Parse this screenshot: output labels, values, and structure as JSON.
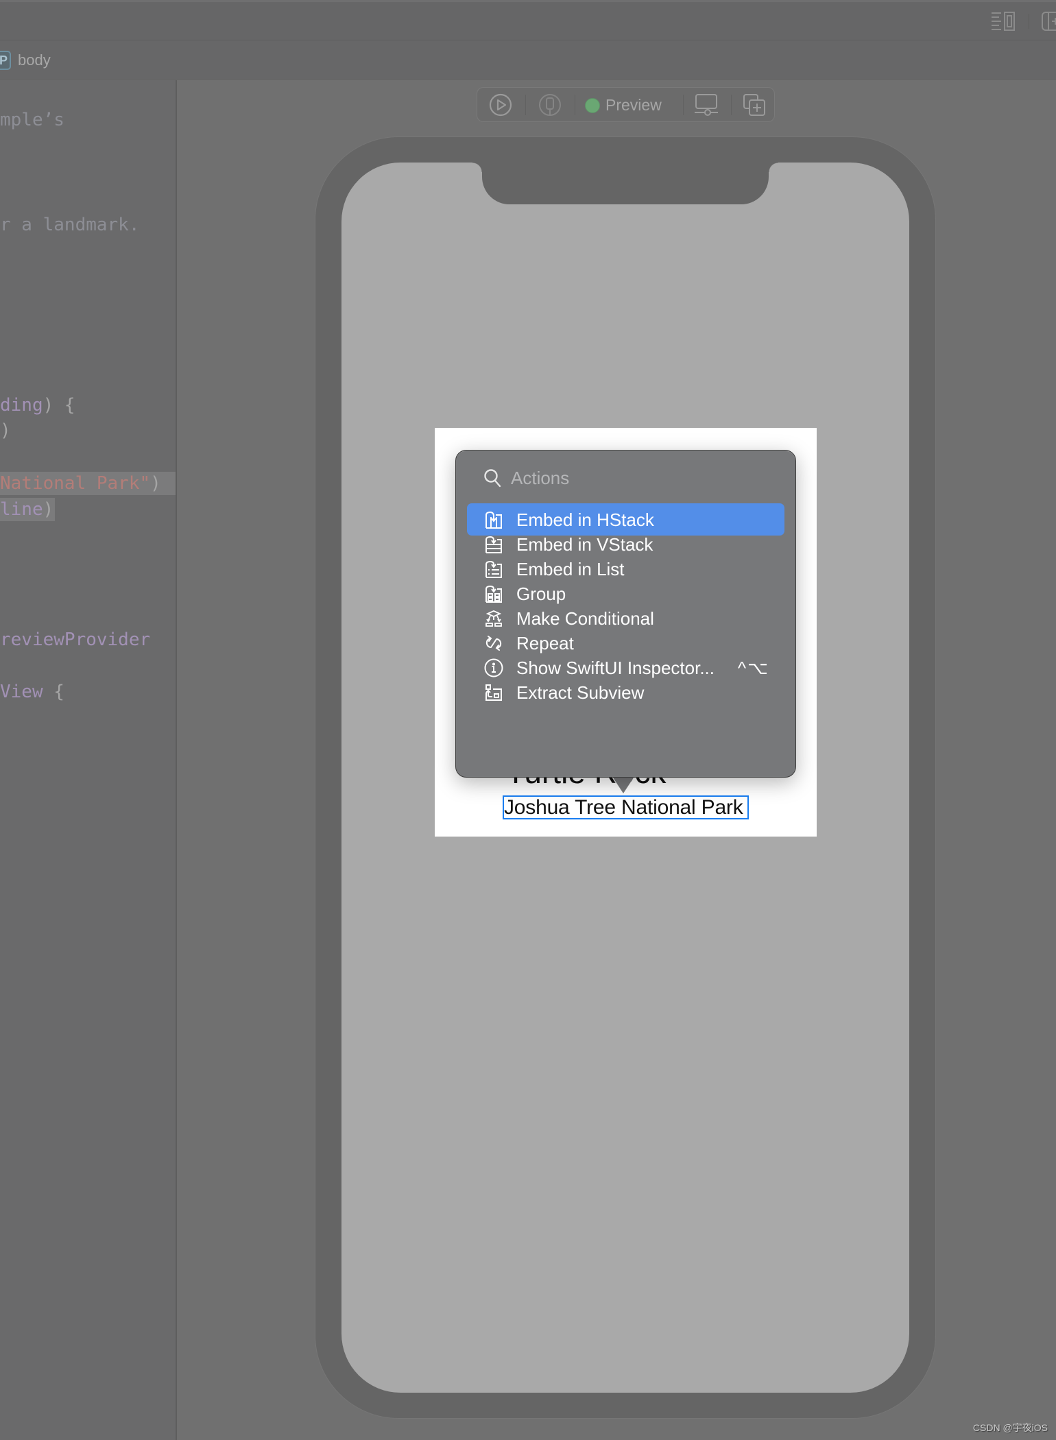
{
  "toolbar": {
    "icons": [
      "editor-options-icon",
      "add-editor-icon"
    ]
  },
  "jumpbar": {
    "badge": "P",
    "label": "body"
  },
  "editor": {
    "lines": [
      {
        "segments": [
          {
            "text": "mple’s",
            "cls": "c-comment"
          }
        ]
      },
      {
        "segments": [
          {
            "text": "r a landmark.",
            "cls": "c-comment"
          }
        ]
      },
      {
        "segments": [
          {
            "text": "ding",
            "cls": "c-type"
          },
          {
            "text": ") {",
            "cls": "c-plain"
          }
        ]
      },
      {
        "segments": [
          {
            "text": ")",
            "cls": "c-plain"
          }
        ]
      },
      {
        "segments": [
          {
            "text": "National Park\"",
            "cls": "c-string"
          },
          {
            "text": ")",
            "cls": "c-plain"
          }
        ]
      },
      {
        "segments": [
          {
            "text": "line",
            "cls": "c-type"
          },
          {
            "text": ")",
            "cls": "c-plain"
          }
        ]
      },
      {
        "segments": [
          {
            "text": "reviewProvider",
            "cls": "c-type"
          }
        ]
      },
      {
        "segments": [
          {
            "text": "View",
            "cls": "c-type"
          },
          {
            "text": " {",
            "cls": "c-plain"
          }
        ]
      }
    ]
  },
  "preview_bar": {
    "status_color": "#6aa773",
    "label": "Preview",
    "buttons": [
      "live-preview-icon",
      "device-icon",
      "device-settings-icon",
      "duplicate-preview-icon"
    ]
  },
  "preview": {
    "title": "Turtle Rock",
    "subtitle": "Joshua Tree National Park",
    "selection_color": "#1a7ef2"
  },
  "actions_menu": {
    "search_placeholder": "Actions",
    "accent": "#538ee8",
    "items": [
      {
        "label": "Embed in HStack",
        "icon": "embed-hstack-icon",
        "selected": true,
        "shortcut": ""
      },
      {
        "label": "Embed in VStack",
        "icon": "embed-vstack-icon",
        "selected": false,
        "shortcut": ""
      },
      {
        "label": "Embed in List",
        "icon": "embed-list-icon",
        "selected": false,
        "shortcut": ""
      },
      {
        "label": "Group",
        "icon": "group-icon",
        "selected": false,
        "shortcut": ""
      },
      {
        "label": "Make Conditional",
        "icon": "conditional-icon",
        "selected": false,
        "shortcut": ""
      },
      {
        "label": "Repeat",
        "icon": "repeat-icon",
        "selected": false,
        "shortcut": ""
      },
      {
        "label": "Show SwiftUI Inspector...",
        "icon": "info-icon",
        "selected": false,
        "shortcut": "^⌥"
      },
      {
        "label": "Extract Subview",
        "icon": "extract-subview-icon",
        "selected": false,
        "shortcut": ""
      }
    ]
  },
  "watermark": "CSDN @宇夜iOS"
}
